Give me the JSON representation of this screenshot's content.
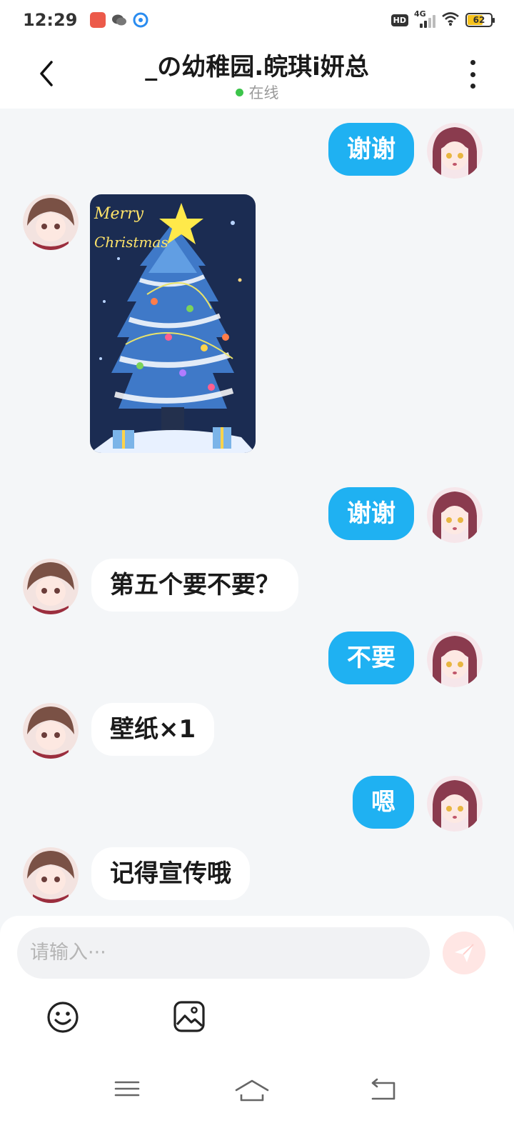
{
  "status_bar": {
    "time": "12:29",
    "network": "4G",
    "battery_percent": "62",
    "hd": "HD",
    "apps": [
      "photo-app-icon",
      "wechat-icon",
      "browser-icon"
    ]
  },
  "header": {
    "title": "_の幼稚园.皖琪i妍总",
    "status": "在线"
  },
  "messages": [
    {
      "side": "me",
      "text": "谢谢"
    },
    {
      "side": "other",
      "type": "image",
      "image_text": [
        "Merry",
        "Christmas"
      ]
    },
    {
      "side": "me",
      "text": "谢谢"
    },
    {
      "side": "other",
      "text": "第五个要不要？"
    },
    {
      "side": "me",
      "text": "不要"
    },
    {
      "side": "other",
      "text": "壁纸×1"
    },
    {
      "side": "me",
      "text": "嗯"
    },
    {
      "side": "other",
      "text": "记得宣传哦"
    }
  ],
  "composer": {
    "placeholder": "请输入···"
  },
  "colors": {
    "accent": "#1fb1f2",
    "online": "#3cc44a",
    "background": "#f4f6f8",
    "send_button_bg": "#ffe6e4"
  }
}
